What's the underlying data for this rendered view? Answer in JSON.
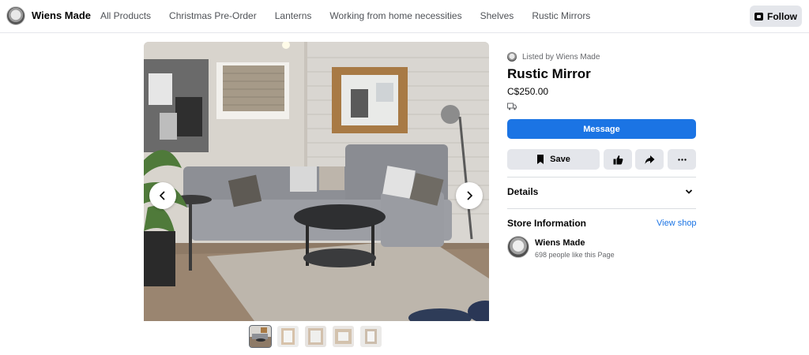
{
  "header": {
    "brand_name": "Wiens Made",
    "nav_items": [
      {
        "label": "All Products"
      },
      {
        "label": "Christmas Pre-Order"
      },
      {
        "label": "Lanterns"
      },
      {
        "label": "Working from home necessities"
      },
      {
        "label": "Shelves"
      },
      {
        "label": "Rustic Mirrors"
      }
    ],
    "follow_label": "Follow",
    "follow_icon": "store-plus-icon"
  },
  "gallery": {
    "main_image": "living-room-rustic-mirror",
    "prev_icon": "chevron-left-icon",
    "next_icon": "chevron-right-icon",
    "thumbnail_count": 5,
    "active_thumbnail": 1
  },
  "listing": {
    "listed_by": "Listed by Wiens Made",
    "title": "Rustic Mirror",
    "price": "C$250.00",
    "shipping_icon": "truck-icon",
    "message_label": "Message",
    "save_label": "Save",
    "details_label": "Details"
  },
  "store": {
    "section_title": "Store Information",
    "view_shop_label": "View shop",
    "name": "Wiens Made",
    "likes": "698 people like this Page"
  },
  "colors": {
    "accent": "#1b74e4",
    "button_grey": "#e4e6eb",
    "text_secondary": "#65676b"
  }
}
